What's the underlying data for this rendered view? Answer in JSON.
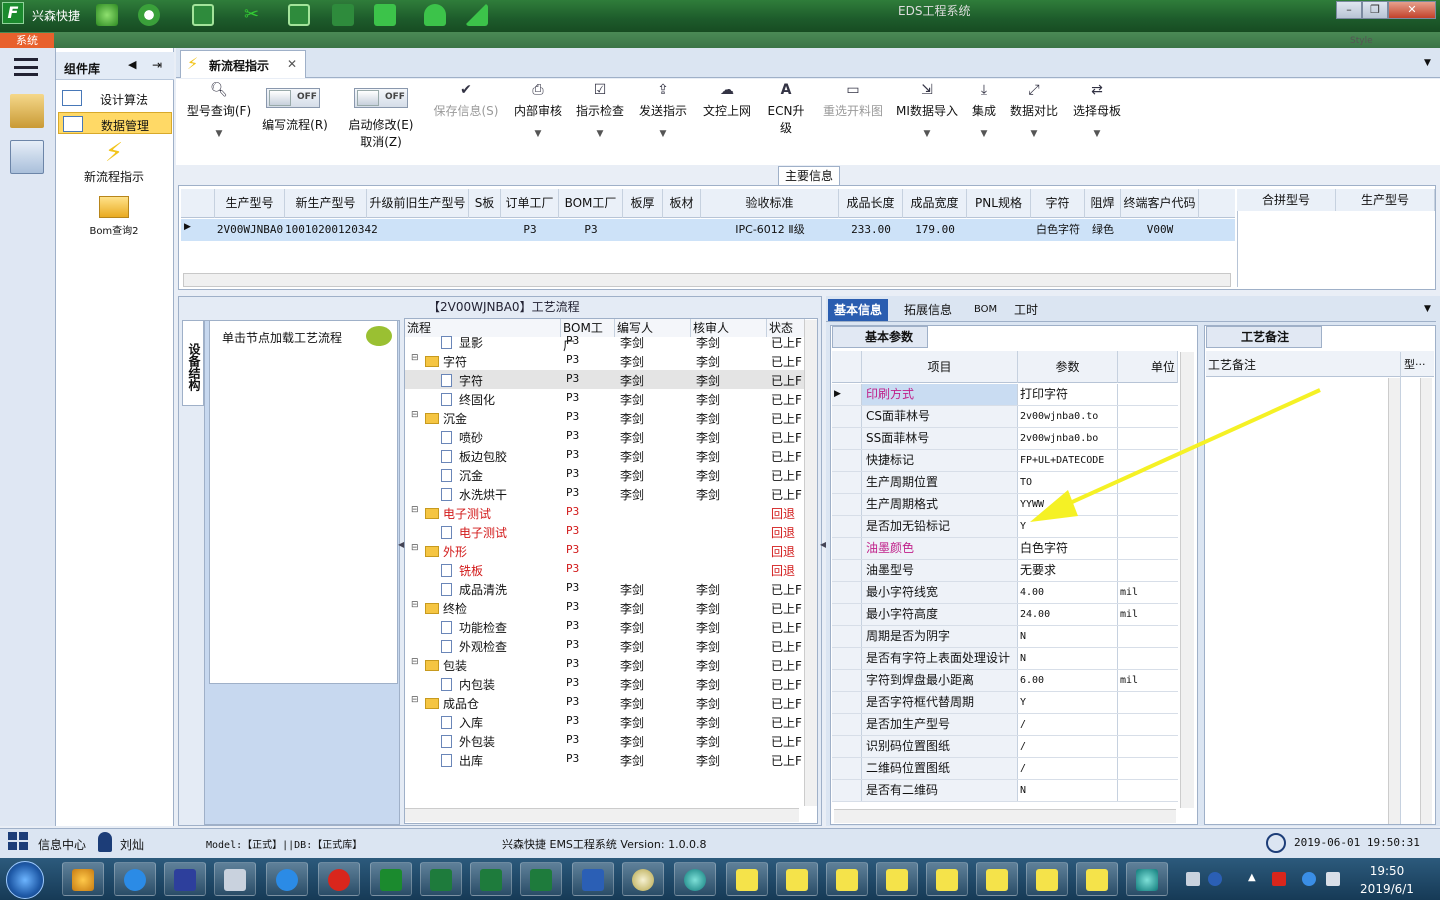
{
  "app": {
    "title": "兴森快捷",
    "window_title": "EDS工程系统",
    "style_label": "Style",
    "system_label": "系统"
  },
  "component_panel": {
    "title": "组件库",
    "items": [
      {
        "label": "设计算法"
      },
      {
        "label": "数据管理"
      }
    ],
    "big_items": [
      {
        "label": "新流程指示"
      },
      {
        "label": "Bom查询2"
      }
    ]
  },
  "tab": {
    "label": "新流程指示"
  },
  "toolbar": {
    "items": [
      {
        "label": "型号查询(F)",
        "enabled": true,
        "icon": "search-icon"
      },
      {
        "label": "编写流程(R)",
        "toggle": "OFF"
      },
      {
        "label": "启动修改(E)",
        "sub": "取消(Z)",
        "toggle": "OFF"
      },
      {
        "label": "保存信息(S)",
        "enabled": false,
        "icon": "check-icon"
      },
      {
        "label": "内部审核",
        "enabled": true,
        "icon": "print-icon"
      },
      {
        "label": "指示检查",
        "enabled": true,
        "icon": "checkbox-icon"
      },
      {
        "label": "发送指示",
        "enabled": true,
        "icon": "upload-icon"
      },
      {
        "label": "文控上网",
        "enabled": true,
        "icon": "cloud-upload-icon"
      },
      {
        "label": "ECN升级",
        "enabled": true,
        "icon": "font-a-icon"
      },
      {
        "label": "重选开料图",
        "enabled": false,
        "icon": "image-icon"
      },
      {
        "label": "MI数据导入",
        "enabled": true,
        "icon": "import-icon"
      },
      {
        "label": "集成",
        "enabled": true,
        "icon": "download-icon"
      },
      {
        "label": "数据对比",
        "enabled": true,
        "icon": "compare-icon"
      },
      {
        "label": "选择母板",
        "enabled": true,
        "icon": "shuffle-icon"
      }
    ]
  },
  "main_info": {
    "label": "主要信息",
    "columns": [
      "生产型号",
      "新生产型号",
      "升级前旧生产型号",
      "S板",
      "订单工厂",
      "BOM工厂",
      "板厚",
      "板材",
      "验收标准",
      "成品长度",
      "成品宽度",
      "PNL规格",
      "字符",
      "阻焊",
      "终端客户代码"
    ],
    "row": [
      "2V00WJNBA0",
      "10010200120342",
      "",
      "",
      "P3",
      "P3",
      "",
      "",
      "IPC-6012 Ⅱ级",
      "233.00",
      "179.00",
      "",
      "白色字符",
      "绿色",
      "V00W"
    ],
    "right_columns": [
      "合拼型号",
      "生产型号"
    ]
  },
  "process": {
    "title": "【2V00WJNBA0】工艺流程",
    "side_tab": "设备结构",
    "node_hint": "单击节点加载工艺流程",
    "columns": [
      "流程",
      "BOM工厂",
      "编写人",
      "核审人",
      "状态"
    ],
    "rows": [
      {
        "name": "显影",
        "level": 2,
        "factory": "P3",
        "writer": "李剑",
        "reviewer": "李剑",
        "status": "已上F",
        "red": false
      },
      {
        "name": "字符",
        "level": 1,
        "factory": "P3",
        "writer": "李剑",
        "reviewer": "李剑",
        "status": "已上F",
        "red": false
      },
      {
        "name": "字符",
        "level": 2,
        "factory": "P3",
        "writer": "李剑",
        "reviewer": "李剑",
        "status": "已上F",
        "red": false
      },
      {
        "name": "终固化",
        "level": 2,
        "factory": "P3",
        "writer": "李剑",
        "reviewer": "李剑",
        "status": "已上F",
        "red": false
      },
      {
        "name": "沉金",
        "level": 1,
        "factory": "P3",
        "writer": "李剑",
        "reviewer": "李剑",
        "status": "已上F",
        "red": false
      },
      {
        "name": "喷砂",
        "level": 2,
        "factory": "P3",
        "writer": "李剑",
        "reviewer": "李剑",
        "status": "已上F",
        "red": false
      },
      {
        "name": "板边包胶",
        "level": 2,
        "factory": "P3",
        "writer": "李剑",
        "reviewer": "李剑",
        "status": "已上F",
        "red": false
      },
      {
        "name": "沉金",
        "level": 2,
        "factory": "P3",
        "writer": "李剑",
        "reviewer": "李剑",
        "status": "已上F",
        "red": false
      },
      {
        "name": "水洗烘干",
        "level": 2,
        "factory": "P3",
        "writer": "李剑",
        "reviewer": "李剑",
        "status": "已上F",
        "red": false
      },
      {
        "name": "电子测试",
        "level": 1,
        "factory": "P3",
        "writer": "",
        "reviewer": "",
        "status": "回退",
        "red": true
      },
      {
        "name": "电子测试",
        "level": 2,
        "factory": "P3",
        "writer": "",
        "reviewer": "",
        "status": "回退",
        "red": true
      },
      {
        "name": "外形",
        "level": 1,
        "factory": "P3",
        "writer": "",
        "reviewer": "",
        "status": "回退",
        "red": true
      },
      {
        "name": "铣板",
        "level": 2,
        "factory": "P3",
        "writer": "",
        "reviewer": "",
        "status": "回退",
        "red": true
      },
      {
        "name": "成品清洗",
        "level": 2,
        "factory": "P3",
        "writer": "李剑",
        "reviewer": "李剑",
        "status": "已上F",
        "red": false
      },
      {
        "name": "终检",
        "level": 1,
        "factory": "P3",
        "writer": "李剑",
        "reviewer": "李剑",
        "status": "已上F",
        "red": false
      },
      {
        "name": "功能检查",
        "level": 2,
        "factory": "P3",
        "writer": "李剑",
        "reviewer": "李剑",
        "status": "已上F",
        "red": false
      },
      {
        "name": "外观检查",
        "level": 2,
        "factory": "P3",
        "writer": "李剑",
        "reviewer": "李剑",
        "status": "已上F",
        "red": false
      },
      {
        "name": "包装",
        "level": 1,
        "factory": "P3",
        "writer": "李剑",
        "reviewer": "李剑",
        "status": "已上F",
        "red": false
      },
      {
        "name": "内包装",
        "level": 2,
        "factory": "P3",
        "writer": "李剑",
        "reviewer": "李剑",
        "status": "已上F",
        "red": false
      },
      {
        "name": "成品仓",
        "level": 1,
        "factory": "P3",
        "writer": "李剑",
        "reviewer": "李剑",
        "status": "已上F",
        "red": false
      },
      {
        "name": "入库",
        "level": 2,
        "factory": "P3",
        "writer": "李剑",
        "reviewer": "李剑",
        "status": "已上F",
        "red": false
      },
      {
        "name": "外包装",
        "level": 2,
        "factory": "P3",
        "writer": "李剑",
        "reviewer": "李剑",
        "status": "已上F",
        "red": false
      },
      {
        "name": "出库",
        "level": 2,
        "factory": "P3",
        "writer": "李剑",
        "reviewer": "李剑",
        "status": "已上F",
        "red": false
      }
    ]
  },
  "right_tabs": [
    "基本信息",
    "拓展信息",
    "BOM",
    "工时"
  ],
  "params": {
    "tab": "基本参数",
    "columns": [
      "项目",
      "参数",
      "单位"
    ],
    "rows": [
      {
        "k": "印刷方式",
        "v": "打印字符",
        "u": "",
        "pink": true,
        "zh": true
      },
      {
        "k": "CS面菲林号",
        "v": "2v00wjnba0.to",
        "u": ""
      },
      {
        "k": "SS面菲林号",
        "v": "2v00wjnba0.bo",
        "u": ""
      },
      {
        "k": "快捷标记",
        "v": "FP+UL+DATECODE",
        "u": ""
      },
      {
        "k": "生产周期位置",
        "v": "TO",
        "u": ""
      },
      {
        "k": "生产周期格式",
        "v": "YYWW",
        "u": ""
      },
      {
        "k": "是否加无铅标记",
        "v": "Y",
        "u": ""
      },
      {
        "k": "油墨颜色",
        "v": "白色字符",
        "u": "",
        "pink": true,
        "zh": true
      },
      {
        "k": "油墨型号",
        "v": "无要求",
        "u": "",
        "zh": true
      },
      {
        "k": "最小字符线宽",
        "v": "4.00",
        "u": "mil"
      },
      {
        "k": "最小字符高度",
        "v": "24.00",
        "u": "mil"
      },
      {
        "k": "周期是否为阴字",
        "v": "N",
        "u": ""
      },
      {
        "k": "是否有字符上表面处理设计",
        "v": "N",
        "u": ""
      },
      {
        "k": "字符到焊盘最小距离",
        "v": "6.00",
        "u": "mil"
      },
      {
        "k": "是否字符框代替周期",
        "v": "Y",
        "u": ""
      },
      {
        "k": "是否加生产型号",
        "v": "/",
        "u": ""
      },
      {
        "k": "识别码位置图纸",
        "v": "/",
        "u": ""
      },
      {
        "k": "二维码位置图纸",
        "v": "/",
        "u": ""
      },
      {
        "k": "是否有二维码",
        "v": "N",
        "u": ""
      }
    ]
  },
  "notes": {
    "tab": "工艺备注",
    "col1": "工艺备注",
    "col2": "型···"
  },
  "status": {
    "info_center": "信息中心",
    "user": "刘灿",
    "model_db": "Model:【正式】||DB:【正式库】",
    "version": "兴森快捷 EMS工程系统 Version: 1.0.0.8",
    "datetime": "2019-06-01 19:50:31"
  },
  "taskbar": {
    "time": "19:50",
    "date": "2019/6/1"
  },
  "colors": {
    "accent": "#2a5db0",
    "title_green": "#1d5b2b",
    "selection": "#cde2f8",
    "red": "#d21a1a",
    "pink": "#c0208a",
    "arrow": "#f5f125"
  }
}
